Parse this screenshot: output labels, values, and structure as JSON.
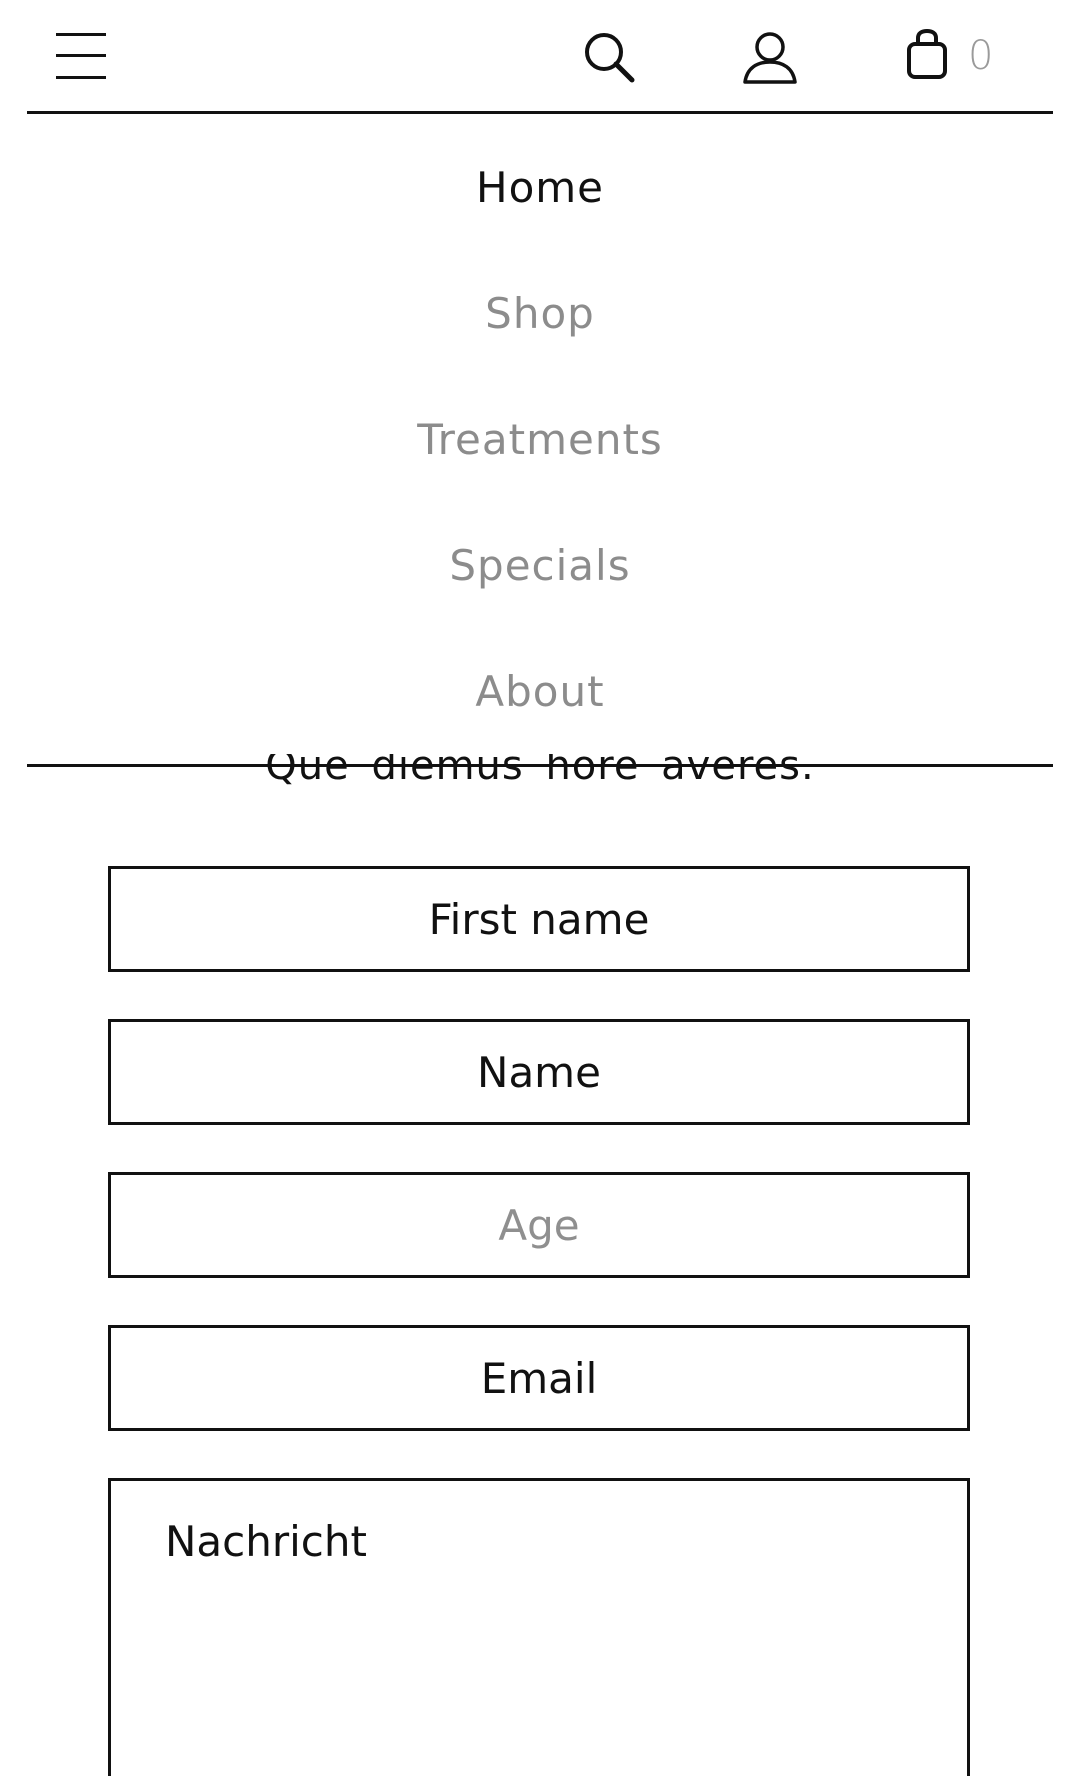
{
  "header": {
    "menu_icon": "hamburger-menu-icon",
    "search_icon": "search-icon",
    "account_icon": "user-account-icon",
    "cart_icon": "shopping-bag-icon",
    "cart_count": "0"
  },
  "nav": {
    "items": [
      {
        "label": "Home",
        "active": true
      },
      {
        "label": "Shop",
        "active": false
      },
      {
        "label": "Treatments",
        "active": false
      },
      {
        "label": "Specials",
        "active": false
      },
      {
        "label": "About",
        "active": false
      }
    ]
  },
  "form": {
    "intro": "Que diemus hore averes.",
    "first_name_placeholder": "First name",
    "name_placeholder": "Name",
    "age_placeholder": "Age",
    "email_placeholder": "Email",
    "message_placeholder": "Nachricht"
  },
  "colors": {
    "text": "#111111",
    "muted": "#8c8c8c",
    "border": "#111111",
    "background": "#ffffff"
  }
}
